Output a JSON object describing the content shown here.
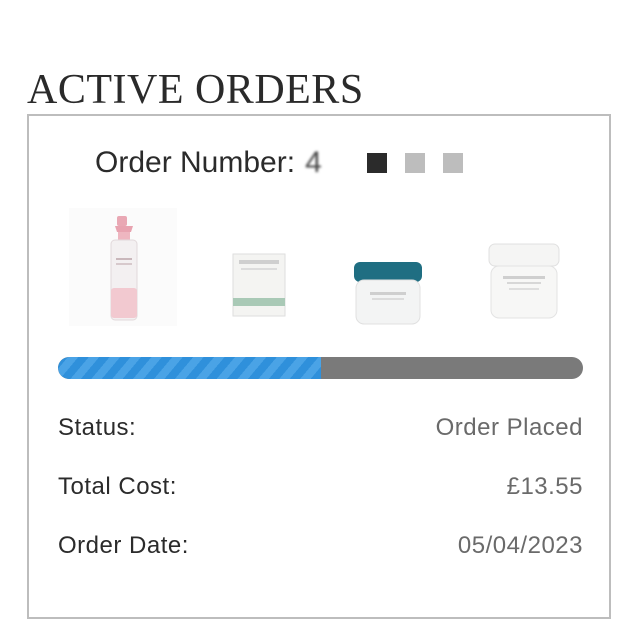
{
  "page": {
    "title": "ACTIVE ORDERS"
  },
  "order": {
    "number_label": "Order Number:",
    "number_value": "4",
    "progress_fraction": 0.5,
    "products": [
      {
        "icon": "spray-bottle-icon"
      },
      {
        "icon": "soap-bar-icon"
      },
      {
        "icon": "cream-jar-teal-lid-icon"
      },
      {
        "icon": "cream-jar-white-icon"
      }
    ],
    "status_label": "Status:",
    "status_value": "Order Placed",
    "total_label": "Total Cost:",
    "total_value": "£13.55",
    "date_label": "Order Date:",
    "date_value": "05/04/2023"
  },
  "colors": {
    "progress_fill": "#2f90db",
    "progress_track": "#7a7a7a",
    "border": "#bdbdbd"
  }
}
